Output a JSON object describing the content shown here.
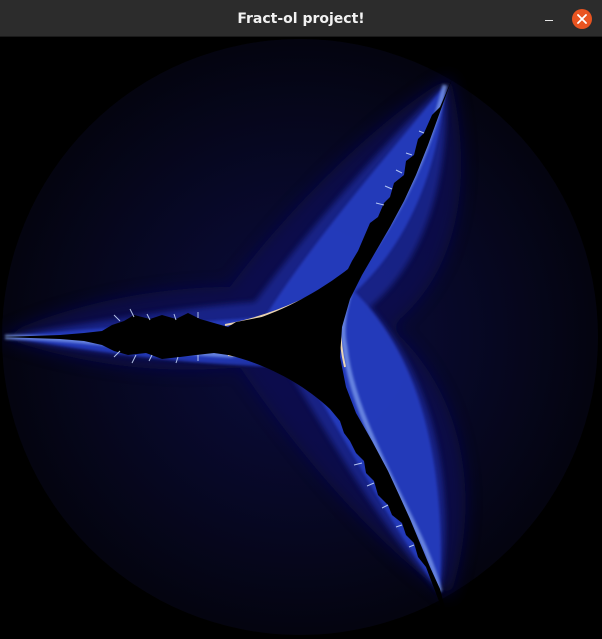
{
  "window": {
    "title": "Fract-ol project!"
  },
  "icons": {
    "minimize": "minimize-icon",
    "close": "close-icon"
  },
  "colors": {
    "titlebar": "#2c2c2c",
    "close_button": "#e95420",
    "background": "#000000",
    "halo_outer": "#050518",
    "halo_inner": "#0a0f5a",
    "edge_glow": "#4d7bff",
    "edge_highlight": "#ffe3b0"
  }
}
